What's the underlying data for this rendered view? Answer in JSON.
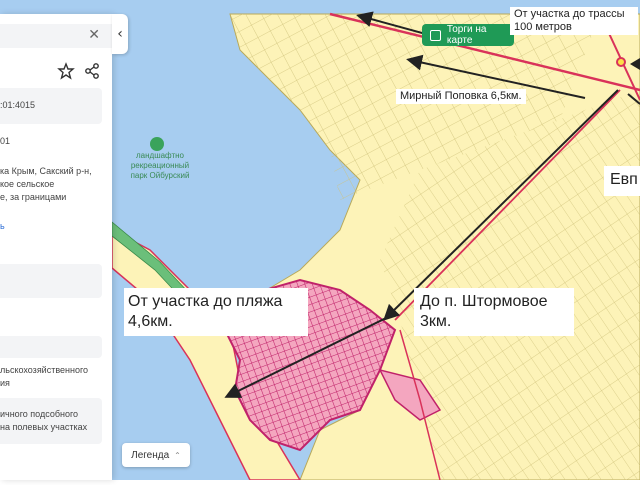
{
  "panel": {
    "close_icon": "close-icon",
    "star_icon": "star-icon",
    "share_icon": "share-icon",
    "cadastral_number_fragment": ":01:4015",
    "code_fragment": "01",
    "address_lines": [
      "ка Крым, Сакский р-н,",
      "кое сельское",
      "е, за границами"
    ],
    "link_fragment": "ь",
    "purpose_lines": [
      "льскохозяйственного",
      "ия"
    ],
    "use_lines": [
      "ичного подсобного",
      "на полевых участках"
    ]
  },
  "map": {
    "torgi_label": "Торги на карте",
    "note_highway": "От участка до трассы\n100 метров",
    "note_mirny": "Мирный Поповка 6,5км.",
    "note_evp": "Евп",
    "note_beach": "От участка до пляжа\n4,6км.",
    "note_shtormovoe": "До п. Штормовое\n3км.",
    "park_label": "ландшафтно\nрекреационный\nпарк Ойбурский",
    "legend_label": "Легенда",
    "collapse_icon": "chevron-left-icon",
    "colors": {
      "water": "#a7cdf0",
      "land": "#fdf3b8",
      "parcel_line": "#cfc27a",
      "settlement": "#f6b6c6",
      "settlement_border": "#c0226a",
      "road": "#d9325a",
      "arrow": "#222222",
      "button": "#1f9a56"
    }
  }
}
